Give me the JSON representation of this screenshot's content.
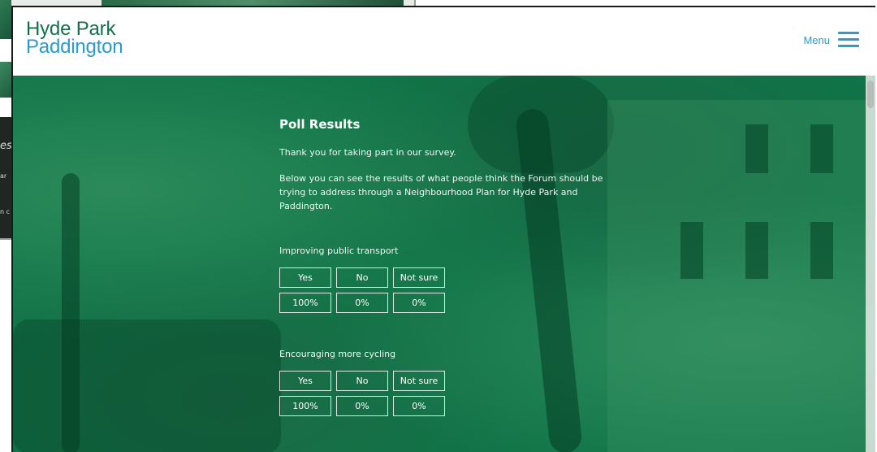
{
  "background_window": {
    "fragments": [
      "es",
      "ar",
      "n c"
    ]
  },
  "header": {
    "logo_line1": "Hyde Park",
    "logo_line2": "Paddington",
    "menu_label": "Menu"
  },
  "poll": {
    "title": "Poll Results",
    "intro": "Thank you for taking part in our survey.",
    "description": "Below you can see the results of what people think the Forum should be trying to address through a Neighbourhood Plan for Hyde Park and Paddington.",
    "questions": [
      {
        "label": "Improving public transport",
        "options": [
          "Yes",
          "No",
          "Not sure"
        ],
        "results": [
          "100%",
          "0%",
          "0%"
        ]
      },
      {
        "label": "Encouraging more cycling",
        "options": [
          "Yes",
          "No",
          "Not sure"
        ],
        "results": [
          "100%",
          "0%",
          "0%"
        ]
      }
    ]
  },
  "colors": {
    "brand_green": "#15704a",
    "brand_blue": "#2a9ad1",
    "hero_green": "#0f7447"
  }
}
